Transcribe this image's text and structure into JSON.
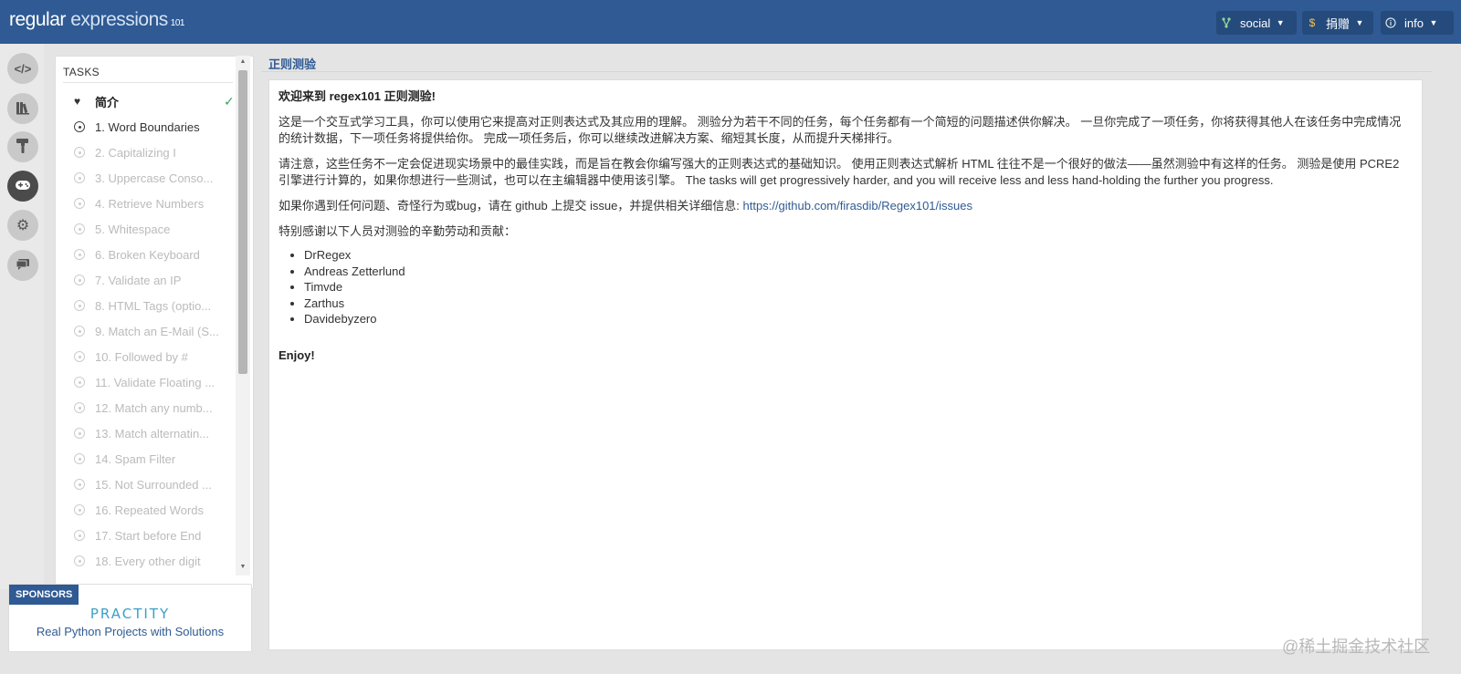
{
  "header": {
    "logo_main": "regular",
    "logo_second": "expressions",
    "logo_suffix": "101",
    "buttons": [
      {
        "label": "social",
        "icon": "branch-icon"
      },
      {
        "label": "捐赠",
        "icon": "dollar-icon"
      },
      {
        "label": "info",
        "icon": "info-icon"
      }
    ]
  },
  "rail": {
    "items": [
      {
        "icon": "code-icon",
        "glyph": "</>"
      },
      {
        "icon": "library-icon",
        "glyph": "▥"
      },
      {
        "icon": "paint-roller-icon",
        "glyph": "T"
      },
      {
        "icon": "gamepad-icon",
        "glyph": "◒",
        "active": true
      },
      {
        "icon": "gear-icon",
        "glyph": "⚙"
      },
      {
        "icon": "chat-icon",
        "glyph": "▬"
      }
    ]
  },
  "tasks": {
    "title": "TASKS",
    "intro": "简介",
    "items": [
      "1. Word Boundaries",
      "2. Capitalizing I",
      "3. Uppercase Conso...",
      "4. Retrieve Numbers",
      "5. Whitespace",
      "6. Broken Keyboard",
      "7. Validate an IP",
      "8. HTML Tags (optio...",
      "9. Match an E-Mail (S...",
      "10. Followed by #",
      "11. Validate Floating ...",
      "12. Match any numb...",
      "13. Match alternatin...",
      "14. Spam Filter",
      "15. Not Surrounded ...",
      "16. Repeated Words",
      "17. Start before End",
      "18. Every other digit"
    ]
  },
  "sponsors": {
    "tag": "SPONSORS",
    "brand": "PRACTITY",
    "text": "Real Python Projects with Solutions"
  },
  "main": {
    "title": "正则测验",
    "welcome": "欢迎来到 regex101 正则测验!",
    "para1": "这是一个交互式学习工具，你可以使用它来提高对正则表达式及其应用的理解。 测验分为若干不同的任务，每个任务都有一个简短的问题描述供你解决。 一旦你完成了一项任务，你将获得其他人在该任务中完成情况的统计数据，下一项任务将提供给你。 完成一项任务后，你可以继续改进解决方案、缩短其长度，从而提升天梯排行。",
    "para2": "请注意，这些任务不一定会促进现实场景中的最佳实践，而是旨在教会你编写强大的正则表达式的基础知识。 使用正则表达式解析 HTML 往往不是一个很好的做法——虽然测验中有这样的任务。 测验是使用 PCRE2 引擎进行计算的，如果你想进行一些测试，也可以在主编辑器中使用该引擎。 The tasks will get progressively harder, and you will receive less and less hand-holding the further you progress.",
    "para3_prefix": "如果你遇到任何问题、奇怪行为或bug，请在 github 上提交 issue，并提供相关详细信息: ",
    "para3_link": "https://github.com/firasdib/Regex101/issues",
    "thanks": "特别感谢以下人员对测验的辛勤劳动和贡献：",
    "contributors": [
      "DrRegex",
      "Andreas Zetterlund",
      "Timvde",
      "Zarthus",
      "Davidebyzero"
    ],
    "enjoy": "Enjoy!"
  },
  "watermark": "@稀土掘金技术社区"
}
